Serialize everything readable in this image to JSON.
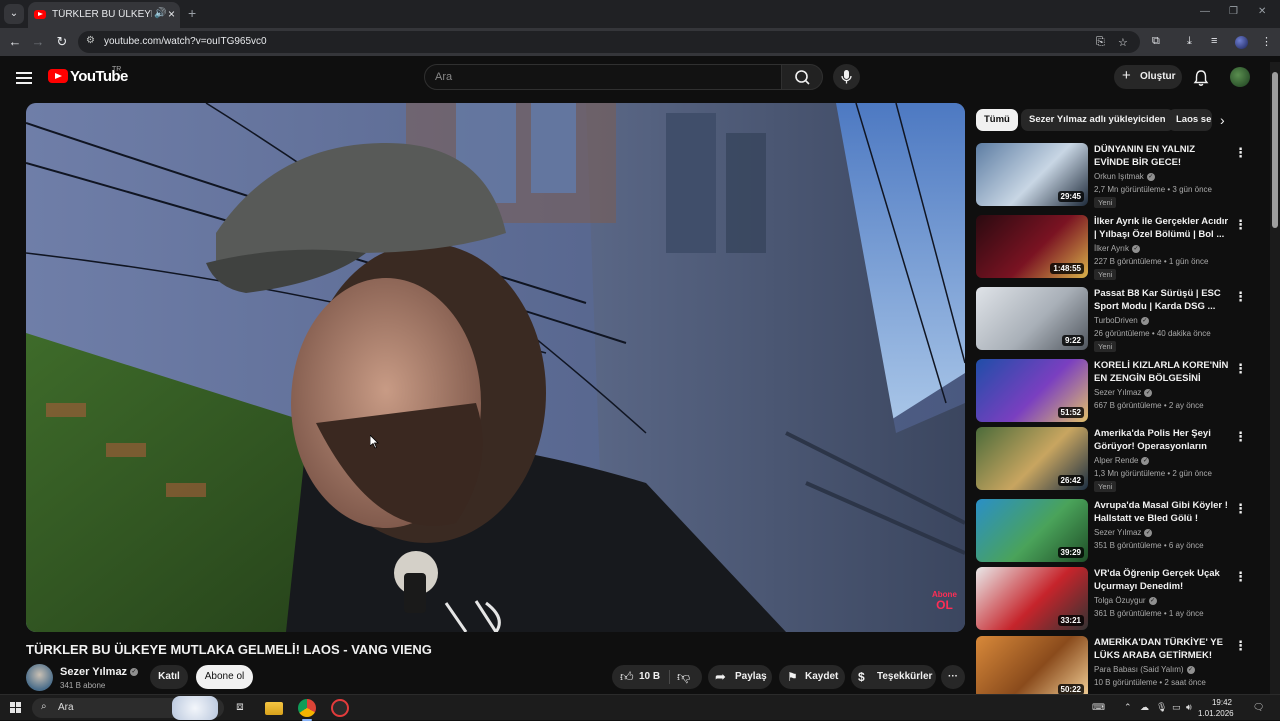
{
  "browser": {
    "tab_title": "TÜRKLER BU ÜLKEYE MUTL",
    "url": "youtube.com/watch?v=ouITG965vc0"
  },
  "header": {
    "logo_text": "YouTube",
    "country_code": "TR",
    "search_placeholder": "Ara",
    "create_label": "Oluştur"
  },
  "video": {
    "title": "TÜRKLER BU ÜLKEYE MUTLAKA GELMELİ! LAOS - VANG VIENG",
    "watermark_top": "Abone",
    "watermark_bottom": "OL",
    "channel_name": "Sezer Yılmaz",
    "subscribers": "341 B abone",
    "join_label": "Katıl",
    "subscribe_label": "Abone ol",
    "likes": "10 B",
    "share_label": "Paylaş",
    "save_label": "Kaydet",
    "thanks_label": "Teşekkürler"
  },
  "chips": [
    "Tümü",
    "Sezer Yılmaz adlı yükleyiciden",
    "Laos se"
  ],
  "recommendations": [
    {
      "title": "DÜNYANIN EN YALNIZ EVİNDE BİR GECE!",
      "channel": "Orkun Işıtmak",
      "meta": "2,7 Mn görüntüleme • 3 gün önce",
      "duration": "29:45",
      "badge": "Yeni",
      "colors": [
        "#5d7da3",
        "#c8d6e4",
        "#1e2a3a"
      ]
    },
    {
      "title": "İlker Ayrık ile Gerçekler Acıdır | Yılbaşı Özel Bölümü | Bol ...",
      "channel": "İlker Ayrık",
      "meta": "227 B görüntüleme • 1 gün önce",
      "duration": "1:48:55",
      "badge": "Yeni",
      "colors": [
        "#2a0a10",
        "#7a1322",
        "#d9b24a"
      ]
    },
    {
      "title": "Passat B8 Kar Sürüşü | ESC Sport Modu | Karda DSG ...",
      "channel": "TurboDriven",
      "meta": "26 görüntüleme • 40 dakika önce",
      "duration": "9:22",
      "badge": "Yeni",
      "colors": [
        "#dfe3e8",
        "#a9b0b8",
        "#50565e"
      ]
    },
    {
      "title": "KORELİ KIZLARLA KORE'NİN EN ZENGİN BÖLGESİNİ GEZDİM!",
      "channel": "Sezer Yılmaz",
      "meta": "667 B görüntüleme • 2 ay önce",
      "duration": "51:52",
      "badge": "",
      "colors": [
        "#1f4ea8",
        "#7a3fc0",
        "#e2c06a"
      ]
    },
    {
      "title": "Amerika'da Polis Her Şeyi Görüyor! Operasyonların Perde...",
      "channel": "Alper Rende",
      "meta": "1,3 Mn görüntüleme • 2 gün önce",
      "duration": "26:42",
      "badge": "Yeni",
      "colors": [
        "#4b6b3a",
        "#c8a560",
        "#1d2f43"
      ]
    },
    {
      "title": "Avrupa'da Masal Gibi Köyler ! Hallstatt ve Bled Gölü !",
      "channel": "Sezer Yılmaz",
      "meta": "351 B görüntüleme • 6 ay önce",
      "duration": "39:29",
      "badge": "",
      "colors": [
        "#2a8fc7",
        "#4aa35a",
        "#1f4f28"
      ]
    },
    {
      "title": "VR'da Öğrenip Gerçek Uçak Uçurmayı Denedim!",
      "channel": "Tolga Özuygur",
      "meta": "361 B görüntüleme • 1 ay önce",
      "duration": "33:21",
      "badge": "",
      "colors": [
        "#e9e9e9",
        "#c6242b",
        "#333"
      ]
    },
    {
      "title": "AMERİKA'DAN TÜRKİYE' YE LÜKS ARABA GETİRMEK!",
      "channel": "Para Babası (Said Yalım)",
      "meta": "10 B görüntüleme • 2 saat önce",
      "duration": "50:22",
      "badge": "",
      "colors": [
        "#d8893a",
        "#8a4b1c",
        "#f4d29a"
      ]
    }
  ],
  "taskbar": {
    "search_label": "Ara",
    "time": "19:42",
    "date": "1.01.2026"
  }
}
